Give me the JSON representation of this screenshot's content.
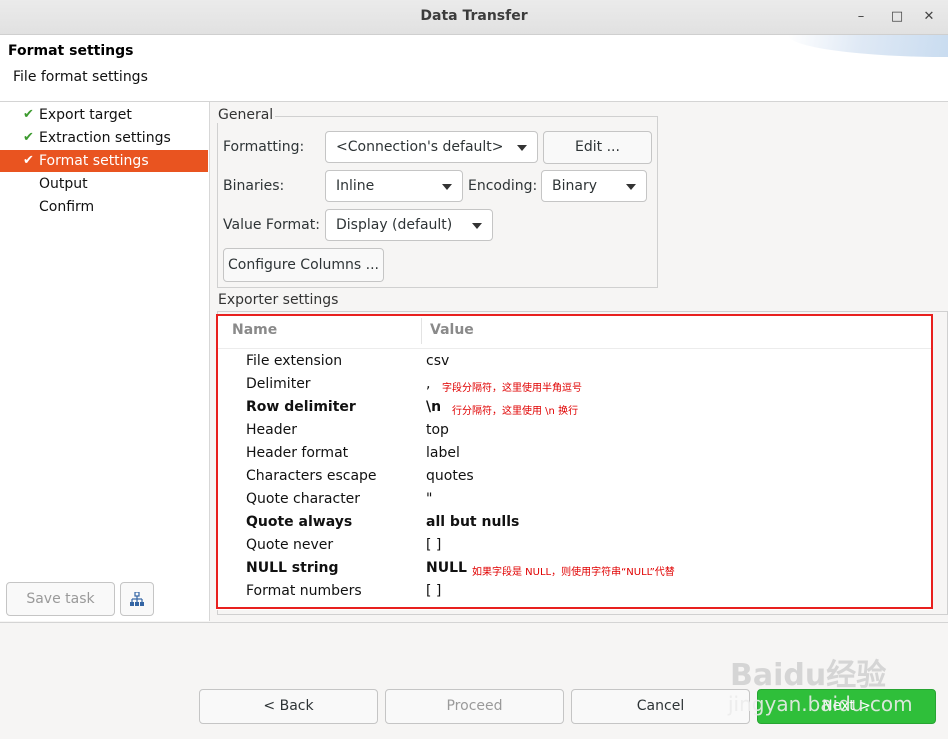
{
  "window": {
    "title": "Data Transfer",
    "minimize_glyph": "–",
    "maximize_glyph": "□",
    "close_glyph": "✕"
  },
  "header": {
    "title": "Format settings",
    "subtitle": "File format settings"
  },
  "nav": {
    "items": [
      {
        "label": "Export target",
        "checked": true
      },
      {
        "label": "Extraction settings",
        "checked": true
      },
      {
        "label": "Format settings",
        "checked": true,
        "active": true
      },
      {
        "label": "Output",
        "checked": false
      },
      {
        "label": "Confirm",
        "checked": false
      }
    ],
    "check_glyph": "✔",
    "save_task_label": "Save task",
    "task_icon": "tree-icon"
  },
  "general": {
    "group_label": "General",
    "formatting_label": "Formatting:",
    "formatting_value": "<Connection's default>",
    "edit_label": "Edit ...",
    "binaries_label": "Binaries:",
    "binaries_value": "Inline",
    "encoding_label": "Encoding:",
    "encoding_value": "Binary",
    "value_format_label": "Value Format:",
    "value_format_value": "Display (default)",
    "configure_columns_label": "Configure Columns ..."
  },
  "exporter": {
    "group_label": "Exporter settings",
    "col_name": "Name",
    "col_value": "Value",
    "rows": [
      {
        "name": "File extension",
        "value": "csv",
        "bold": false,
        "note": ""
      },
      {
        "name": "Delimiter",
        "value": ",",
        "bold": false,
        "note": "字段分隔符，这里使用半角逗号"
      },
      {
        "name": "Row delimiter",
        "value": "\\n",
        "bold": true,
        "note": "行分隔符，这里使用 \\n 换行"
      },
      {
        "name": "Header",
        "value": "top",
        "bold": false,
        "note": ""
      },
      {
        "name": "Header format",
        "value": "label",
        "bold": false,
        "note": ""
      },
      {
        "name": "Characters escape",
        "value": "quotes",
        "bold": false,
        "note": ""
      },
      {
        "name": "Quote character",
        "value": "\"",
        "bold": false,
        "note": ""
      },
      {
        "name": "Quote always",
        "value": "all but nulls",
        "bold": true,
        "note": ""
      },
      {
        "name": "Quote never",
        "value": "[ ]",
        "bold": false,
        "note": ""
      },
      {
        "name": "NULL string",
        "value": "NULL",
        "bold": true,
        "note": "如果字段是 NULL，则使用字符串“NULL”代替"
      },
      {
        "name": "Format numbers",
        "value": "[ ]",
        "bold": false,
        "note": ""
      }
    ]
  },
  "footer": {
    "back_label": "< Back",
    "proceed_label": "Proceed",
    "cancel_label": "Cancel",
    "next_label": "Next >"
  },
  "watermark": {
    "brand": "Baidu经验",
    "url": "jingyan.baidu.com"
  },
  "colors": {
    "accent": "#e95420",
    "check": "#3c9a2e",
    "annotation_red": "#e8201e",
    "primary_button": "#2fbf3a"
  }
}
